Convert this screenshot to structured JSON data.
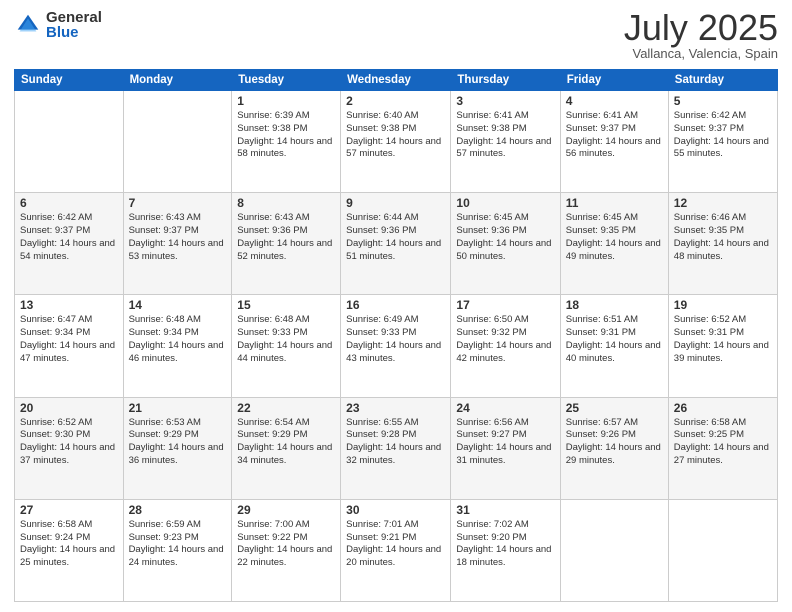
{
  "logo": {
    "general": "General",
    "blue": "Blue"
  },
  "title": "July 2025",
  "subtitle": "Vallanca, Valencia, Spain",
  "headers": [
    "Sunday",
    "Monday",
    "Tuesday",
    "Wednesday",
    "Thursday",
    "Friday",
    "Saturday"
  ],
  "weeks": [
    [
      {
        "day": "",
        "sunrise": "",
        "sunset": "",
        "daylight": ""
      },
      {
        "day": "",
        "sunrise": "",
        "sunset": "",
        "daylight": ""
      },
      {
        "day": "1",
        "sunrise": "Sunrise: 6:39 AM",
        "sunset": "Sunset: 9:38 PM",
        "daylight": "Daylight: 14 hours and 58 minutes."
      },
      {
        "day": "2",
        "sunrise": "Sunrise: 6:40 AM",
        "sunset": "Sunset: 9:38 PM",
        "daylight": "Daylight: 14 hours and 57 minutes."
      },
      {
        "day": "3",
        "sunrise": "Sunrise: 6:41 AM",
        "sunset": "Sunset: 9:38 PM",
        "daylight": "Daylight: 14 hours and 57 minutes."
      },
      {
        "day": "4",
        "sunrise": "Sunrise: 6:41 AM",
        "sunset": "Sunset: 9:37 PM",
        "daylight": "Daylight: 14 hours and 56 minutes."
      },
      {
        "day": "5",
        "sunrise": "Sunrise: 6:42 AM",
        "sunset": "Sunset: 9:37 PM",
        "daylight": "Daylight: 14 hours and 55 minutes."
      }
    ],
    [
      {
        "day": "6",
        "sunrise": "Sunrise: 6:42 AM",
        "sunset": "Sunset: 9:37 PM",
        "daylight": "Daylight: 14 hours and 54 minutes."
      },
      {
        "day": "7",
        "sunrise": "Sunrise: 6:43 AM",
        "sunset": "Sunset: 9:37 PM",
        "daylight": "Daylight: 14 hours and 53 minutes."
      },
      {
        "day": "8",
        "sunrise": "Sunrise: 6:43 AM",
        "sunset": "Sunset: 9:36 PM",
        "daylight": "Daylight: 14 hours and 52 minutes."
      },
      {
        "day": "9",
        "sunrise": "Sunrise: 6:44 AM",
        "sunset": "Sunset: 9:36 PM",
        "daylight": "Daylight: 14 hours and 51 minutes."
      },
      {
        "day": "10",
        "sunrise": "Sunrise: 6:45 AM",
        "sunset": "Sunset: 9:36 PM",
        "daylight": "Daylight: 14 hours and 50 minutes."
      },
      {
        "day": "11",
        "sunrise": "Sunrise: 6:45 AM",
        "sunset": "Sunset: 9:35 PM",
        "daylight": "Daylight: 14 hours and 49 minutes."
      },
      {
        "day": "12",
        "sunrise": "Sunrise: 6:46 AM",
        "sunset": "Sunset: 9:35 PM",
        "daylight": "Daylight: 14 hours and 48 minutes."
      }
    ],
    [
      {
        "day": "13",
        "sunrise": "Sunrise: 6:47 AM",
        "sunset": "Sunset: 9:34 PM",
        "daylight": "Daylight: 14 hours and 47 minutes."
      },
      {
        "day": "14",
        "sunrise": "Sunrise: 6:48 AM",
        "sunset": "Sunset: 9:34 PM",
        "daylight": "Daylight: 14 hours and 46 minutes."
      },
      {
        "day": "15",
        "sunrise": "Sunrise: 6:48 AM",
        "sunset": "Sunset: 9:33 PM",
        "daylight": "Daylight: 14 hours and 44 minutes."
      },
      {
        "day": "16",
        "sunrise": "Sunrise: 6:49 AM",
        "sunset": "Sunset: 9:33 PM",
        "daylight": "Daylight: 14 hours and 43 minutes."
      },
      {
        "day": "17",
        "sunrise": "Sunrise: 6:50 AM",
        "sunset": "Sunset: 9:32 PM",
        "daylight": "Daylight: 14 hours and 42 minutes."
      },
      {
        "day": "18",
        "sunrise": "Sunrise: 6:51 AM",
        "sunset": "Sunset: 9:31 PM",
        "daylight": "Daylight: 14 hours and 40 minutes."
      },
      {
        "day": "19",
        "sunrise": "Sunrise: 6:52 AM",
        "sunset": "Sunset: 9:31 PM",
        "daylight": "Daylight: 14 hours and 39 minutes."
      }
    ],
    [
      {
        "day": "20",
        "sunrise": "Sunrise: 6:52 AM",
        "sunset": "Sunset: 9:30 PM",
        "daylight": "Daylight: 14 hours and 37 minutes."
      },
      {
        "day": "21",
        "sunrise": "Sunrise: 6:53 AM",
        "sunset": "Sunset: 9:29 PM",
        "daylight": "Daylight: 14 hours and 36 minutes."
      },
      {
        "day": "22",
        "sunrise": "Sunrise: 6:54 AM",
        "sunset": "Sunset: 9:29 PM",
        "daylight": "Daylight: 14 hours and 34 minutes."
      },
      {
        "day": "23",
        "sunrise": "Sunrise: 6:55 AM",
        "sunset": "Sunset: 9:28 PM",
        "daylight": "Daylight: 14 hours and 32 minutes."
      },
      {
        "day": "24",
        "sunrise": "Sunrise: 6:56 AM",
        "sunset": "Sunset: 9:27 PM",
        "daylight": "Daylight: 14 hours and 31 minutes."
      },
      {
        "day": "25",
        "sunrise": "Sunrise: 6:57 AM",
        "sunset": "Sunset: 9:26 PM",
        "daylight": "Daylight: 14 hours and 29 minutes."
      },
      {
        "day": "26",
        "sunrise": "Sunrise: 6:58 AM",
        "sunset": "Sunset: 9:25 PM",
        "daylight": "Daylight: 14 hours and 27 minutes."
      }
    ],
    [
      {
        "day": "27",
        "sunrise": "Sunrise: 6:58 AM",
        "sunset": "Sunset: 9:24 PM",
        "daylight": "Daylight: 14 hours and 25 minutes."
      },
      {
        "day": "28",
        "sunrise": "Sunrise: 6:59 AM",
        "sunset": "Sunset: 9:23 PM",
        "daylight": "Daylight: 14 hours and 24 minutes."
      },
      {
        "day": "29",
        "sunrise": "Sunrise: 7:00 AM",
        "sunset": "Sunset: 9:22 PM",
        "daylight": "Daylight: 14 hours and 22 minutes."
      },
      {
        "day": "30",
        "sunrise": "Sunrise: 7:01 AM",
        "sunset": "Sunset: 9:21 PM",
        "daylight": "Daylight: 14 hours and 20 minutes."
      },
      {
        "day": "31",
        "sunrise": "Sunrise: 7:02 AM",
        "sunset": "Sunset: 9:20 PM",
        "daylight": "Daylight: 14 hours and 18 minutes."
      },
      {
        "day": "",
        "sunrise": "",
        "sunset": "",
        "daylight": ""
      },
      {
        "day": "",
        "sunrise": "",
        "sunset": "",
        "daylight": ""
      }
    ]
  ]
}
